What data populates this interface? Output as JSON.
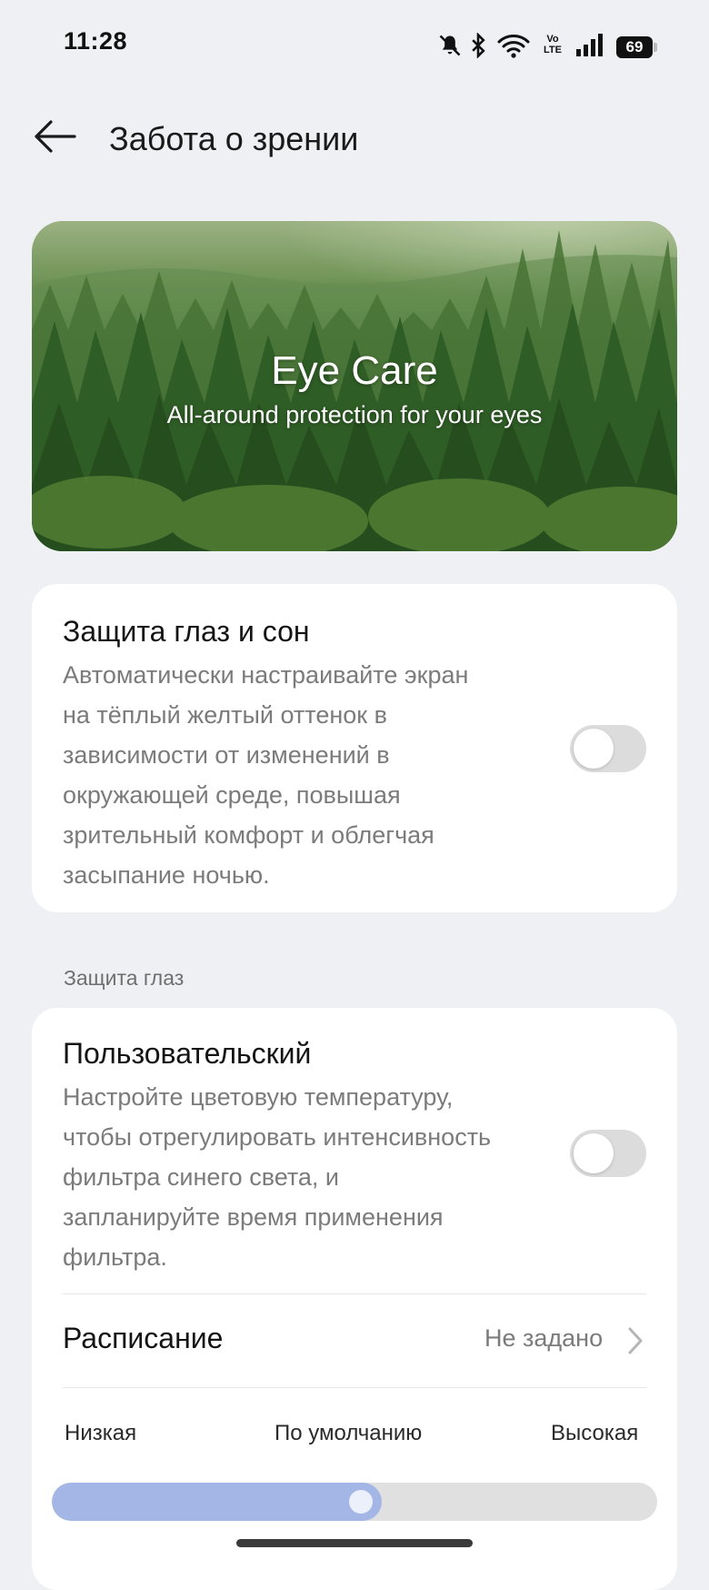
{
  "status_bar": {
    "time": "11:28",
    "battery": "69",
    "network_label": "Vo LTE"
  },
  "header": {
    "title": "Забота о зрении"
  },
  "banner": {
    "title": "Eye Care",
    "subtitle": "All-around protection for your eyes"
  },
  "eye_sleep": {
    "title": "Защита глаз и сон",
    "description": "Автоматически настраивайте экран на тёплый желтый оттенок в зависимости от изменений в окружающей среде, повышая зрительный комфорт и облегчая засыпание ночью.",
    "enabled": false
  },
  "section_label": "Защита глаз",
  "custom": {
    "title": "Пользовательский",
    "description": "Настройте цветовую температуру, чтобы отрегулировать интенсивность фильтра синего света, и запланируйте время применения фильтра.",
    "enabled": false
  },
  "schedule": {
    "label": "Расписание",
    "value": "Не задано"
  },
  "intensity": {
    "min_label": "Низкая",
    "mid_label": "По умолчанию",
    "max_label": "Высокая",
    "value": 0.5
  },
  "colors": {
    "slider_fill": "#a4b6e6",
    "toggle_off": "#dcdcdc",
    "background": "#eef0f3"
  }
}
